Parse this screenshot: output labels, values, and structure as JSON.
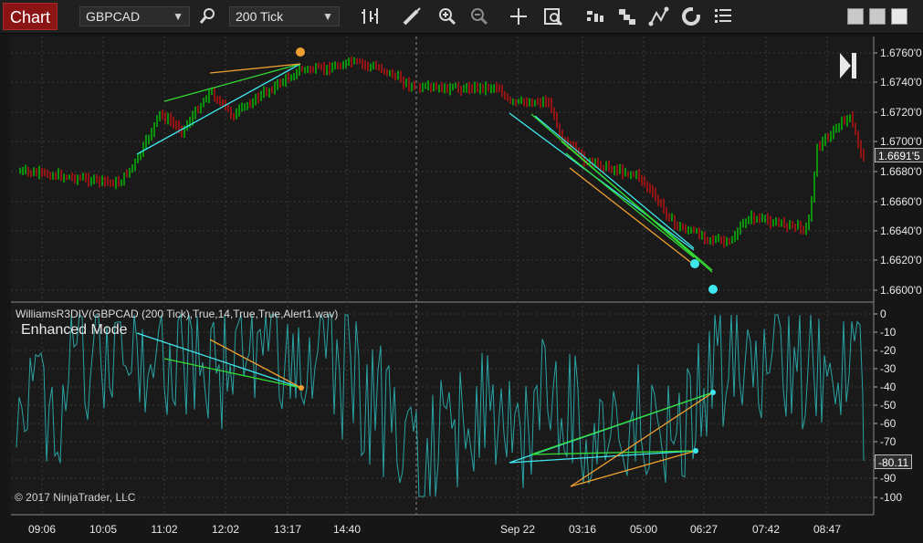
{
  "toolbar": {
    "tab_label": "Chart",
    "instrument": "GBPCAD",
    "interval": "200 Tick",
    "icons": [
      "bar-type-icon",
      "draw-pencil-icon",
      "zoom-in-icon",
      "zoom-out-icon",
      "crosshair-icon",
      "data-box-icon",
      "indicators-icon",
      "strategies-icon",
      "drawing-tools-icon",
      "reload-icon",
      "properties-icon"
    ]
  },
  "price_panel": {
    "price_ticks": [
      "1.6760'0",
      "1.6740'0",
      "1.6720'0",
      "1.6700'0",
      "1.6680'0",
      "1.6660'0",
      "1.6640'0",
      "1.6620'0",
      "1.6600'0"
    ],
    "last_price_tag": "1.6691'5",
    "colors": {
      "up": "#00e000",
      "down": "#e01010"
    }
  },
  "indicator_panel": {
    "label": "WilliamsR3DIV(GBPCAD (200 Tick),True,14,True,True,Alert1.wav)",
    "mode_label": "Enhanced Mode",
    "ticks": [
      "0",
      "-10",
      "-20",
      "-30",
      "-40",
      "-50",
      "-60",
      "-70",
      "-80",
      "-90",
      "-100"
    ],
    "last_value_tag": "-80.11",
    "line_color": "#2aa3a3"
  },
  "time_axis": [
    "09:06",
    "10:05",
    "11:02",
    "12:02",
    "13:17",
    "14:40",
    "Sep 22",
    "03:16",
    "05:00",
    "06:27",
    "07:42",
    "08:47"
  ],
  "copyright": "© 2017 NinjaTrader, LLC",
  "divergence_colors": {
    "cyan": "#3ee8ee",
    "green": "#33dd33",
    "orange": "#f0a030"
  }
}
